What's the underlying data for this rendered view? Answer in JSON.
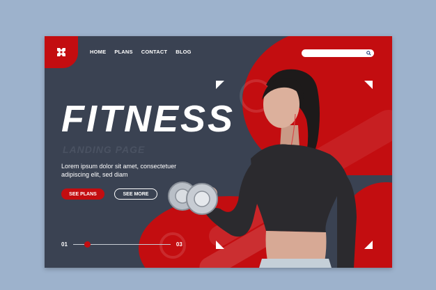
{
  "nav": {
    "items": [
      "HOME",
      "PLANS",
      "CONTACT",
      "BLOG"
    ]
  },
  "search": {
    "placeholder": ""
  },
  "hero": {
    "title": "FITNESS",
    "subtitle": "LANDING PAGE",
    "description": "Lorem ipsum dolor sit amet, consectetuer adipiscing elit, sed diam",
    "primary_button": "SEE PLANS",
    "secondary_button": "SEE MORE"
  },
  "pager": {
    "start": "01",
    "end": "03",
    "progress": 0.15
  },
  "colors": {
    "accent": "#c30d10",
    "panel": "#3a4252",
    "backdrop": "#9db2cc"
  },
  "icons": [
    "logo-icon",
    "search-icon"
  ]
}
